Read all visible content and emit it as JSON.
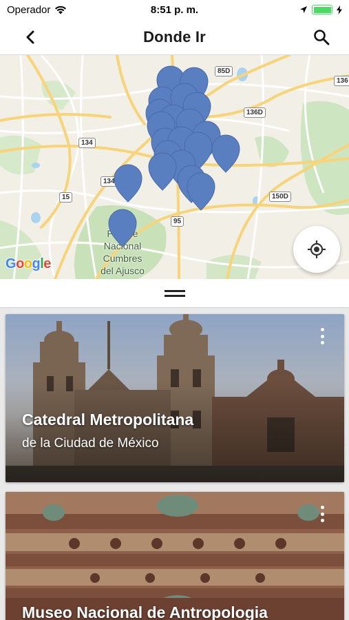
{
  "status_bar": {
    "carrier": "Operador",
    "time": "8:51 p. m.",
    "battery_level": 1.0,
    "battery_color": "#4cd964"
  },
  "nav": {
    "title": "Donde Ir",
    "back_icon": "chevron-left-icon",
    "search_icon": "search-icon"
  },
  "map": {
    "labels": {
      "park": "Parque\nNacional\nCumbres\ndel Ajusco",
      "city_fragment": "de"
    },
    "road_shields": [
      "85D",
      "136",
      "136D",
      "134",
      "134",
      "15",
      "95",
      "150D"
    ],
    "attribution": "Google",
    "marker_color": "#5a7fc0",
    "locate_icon": "my-location-icon"
  },
  "cards": [
    {
      "title": "Catedral Metropolitana",
      "subtitle": "de la Ciudad de México",
      "image": "cathedral-photo"
    },
    {
      "title": "Museo Nacional de Antropologia",
      "subtitle": "",
      "image": "museum-photo"
    }
  ]
}
